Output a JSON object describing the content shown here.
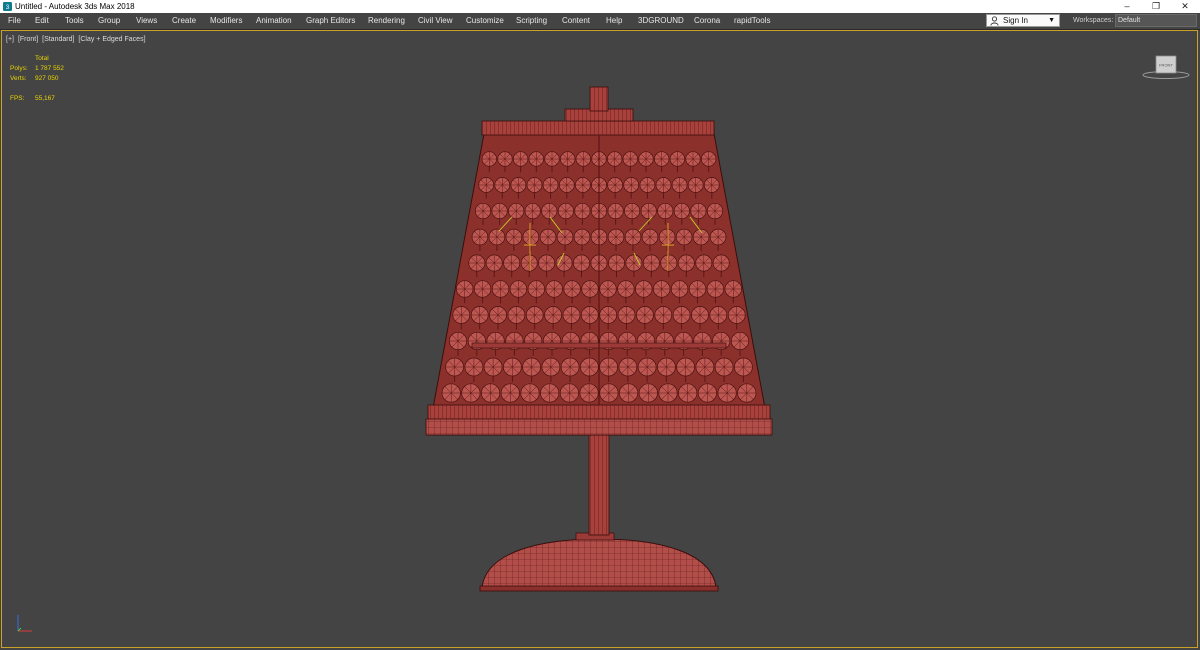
{
  "window": {
    "title": "Untitled - Autodesk 3ds Max 2018",
    "controls": [
      "–",
      "❐",
      "✕"
    ]
  },
  "menu": {
    "items": [
      "File",
      "Edit",
      "Tools",
      "Group",
      "Views",
      "Create",
      "Modifiers",
      "Animation",
      "Graph Editors",
      "Rendering",
      "Civil View",
      "Customize",
      "Scripting",
      "Content",
      "Help",
      "3DGROUND",
      "Corona",
      "rapidTools"
    ]
  },
  "account": {
    "sign_in_label": "Sign In",
    "workspaces_label": "Workspaces:",
    "workspace_value": "Default"
  },
  "viewport": {
    "labels": [
      "[+]",
      "[Front]",
      "[Standard]",
      "[Clay + Edged Faces]"
    ],
    "stats": {
      "header": "Total",
      "rows": [
        {
          "key": "Polys:",
          "value": "1 787 552"
        },
        {
          "key": "Verts:",
          "value": "927 050"
        }
      ],
      "fps_key": "FPS:",
      "fps_value": "55,167"
    },
    "viewcube_label": "FRONT"
  },
  "colors": {
    "viewport_bg": "#444444",
    "active_border": "#c9a227",
    "stats_text": "#e8d400",
    "mesh_fill": "#b24e4a",
    "mesh_wire": "#5a1715"
  },
  "icons": {
    "app": "3ds-max-app-icon",
    "user": "user-icon",
    "axis": "axis-tripod-icon",
    "viewcube": "viewcube-icon"
  }
}
